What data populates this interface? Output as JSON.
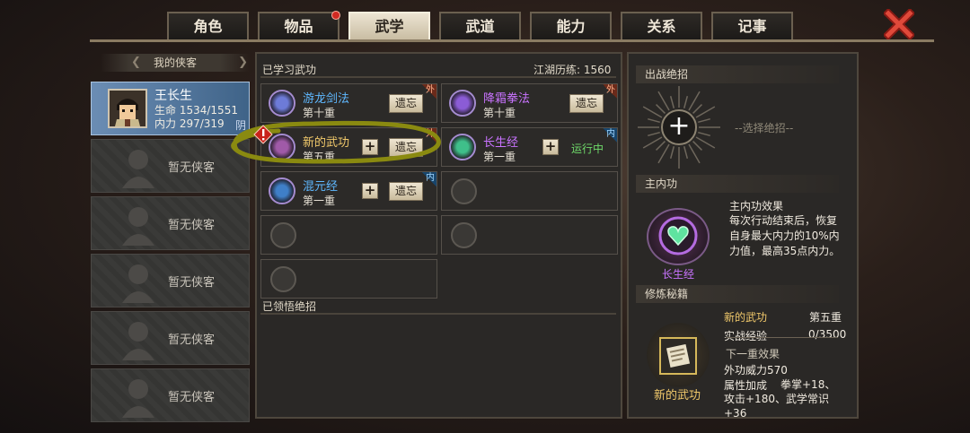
{
  "tabs": [
    {
      "label": "角色",
      "active": false,
      "badge": false
    },
    {
      "label": "物品",
      "active": false,
      "badge": true
    },
    {
      "label": "武学",
      "active": true,
      "badge": false
    },
    {
      "label": "武道",
      "active": false,
      "badge": false
    },
    {
      "label": "能力",
      "active": false,
      "badge": false
    },
    {
      "label": "关系",
      "active": false,
      "badge": false
    },
    {
      "label": "记事",
      "active": false,
      "badge": false
    }
  ],
  "close_icon": "close-x-icon",
  "hero_list": {
    "title": "我的侠客",
    "active": {
      "name": "王长生",
      "hp_label": "生命",
      "hp": "1534/1551",
      "mp_label": "内力",
      "mp": "297/319",
      "tag": "阴"
    },
    "empty_label": "暂无侠客",
    "empty_count": 5
  },
  "learned": {
    "title": "已学习武功",
    "experience_label": "江湖历练:",
    "experience_value": "1560",
    "skills": [
      {
        "name": "游龙剑法",
        "level": "第十重",
        "color": "#5fb8ff",
        "tag": "外",
        "tag_type": "wai",
        "action": "遗忘",
        "plus": false,
        "running": false,
        "icon_color": "#6d7bd8"
      },
      {
        "name": "降霜拳法",
        "level": "第十重",
        "color": "#c973ff",
        "tag": "外",
        "tag_type": "wai",
        "action": "遗忘",
        "plus": false,
        "running": false,
        "icon_color": "#8b5cd6"
      },
      {
        "name": "新的武功",
        "level": "第五重",
        "color": "#f1c96b",
        "tag": "外",
        "tag_type": "wai",
        "action": "遗忘",
        "plus": true,
        "running": false,
        "icon_color": "#a05aa8"
      },
      {
        "name": "长生经",
        "level": "第一重",
        "color": "#c973ff",
        "tag": "内",
        "tag_type": "nei",
        "action": "",
        "plus": true,
        "running": true,
        "running_text": "运行中",
        "icon_color": "#3fbf8a"
      },
      {
        "name": "混元经",
        "level": "第一重",
        "color": "#5fb8ff",
        "tag": "内",
        "tag_type": "nei",
        "action": "遗忘",
        "plus": true,
        "running": false,
        "icon_color": "#3f7fc8"
      }
    ],
    "empty_slots": 4
  },
  "ultimates": {
    "title": "已领悟绝招"
  },
  "right_panel": {
    "battle_title": "出战绝招",
    "battle_placeholder": "--选择绝招--",
    "inner_title": "主内功",
    "inner_effect_title": "主内功效果",
    "inner_effect_text": "每次行动结束后，恢复自身最大内力的10%内力值，最高35点内力。",
    "inner_name": "长生经",
    "manual_title": "修炼秘籍",
    "manual_skill": "新的武功",
    "manual_level": "第五重",
    "exp_label": "实战经验",
    "exp_value": "0/3500",
    "next_label": "下一重效果",
    "power_text": "外功威力570",
    "attr_label": "属性加成",
    "attr_text": "拳掌+18、攻击+180、武学常识+36",
    "book_name": "新的武功"
  }
}
